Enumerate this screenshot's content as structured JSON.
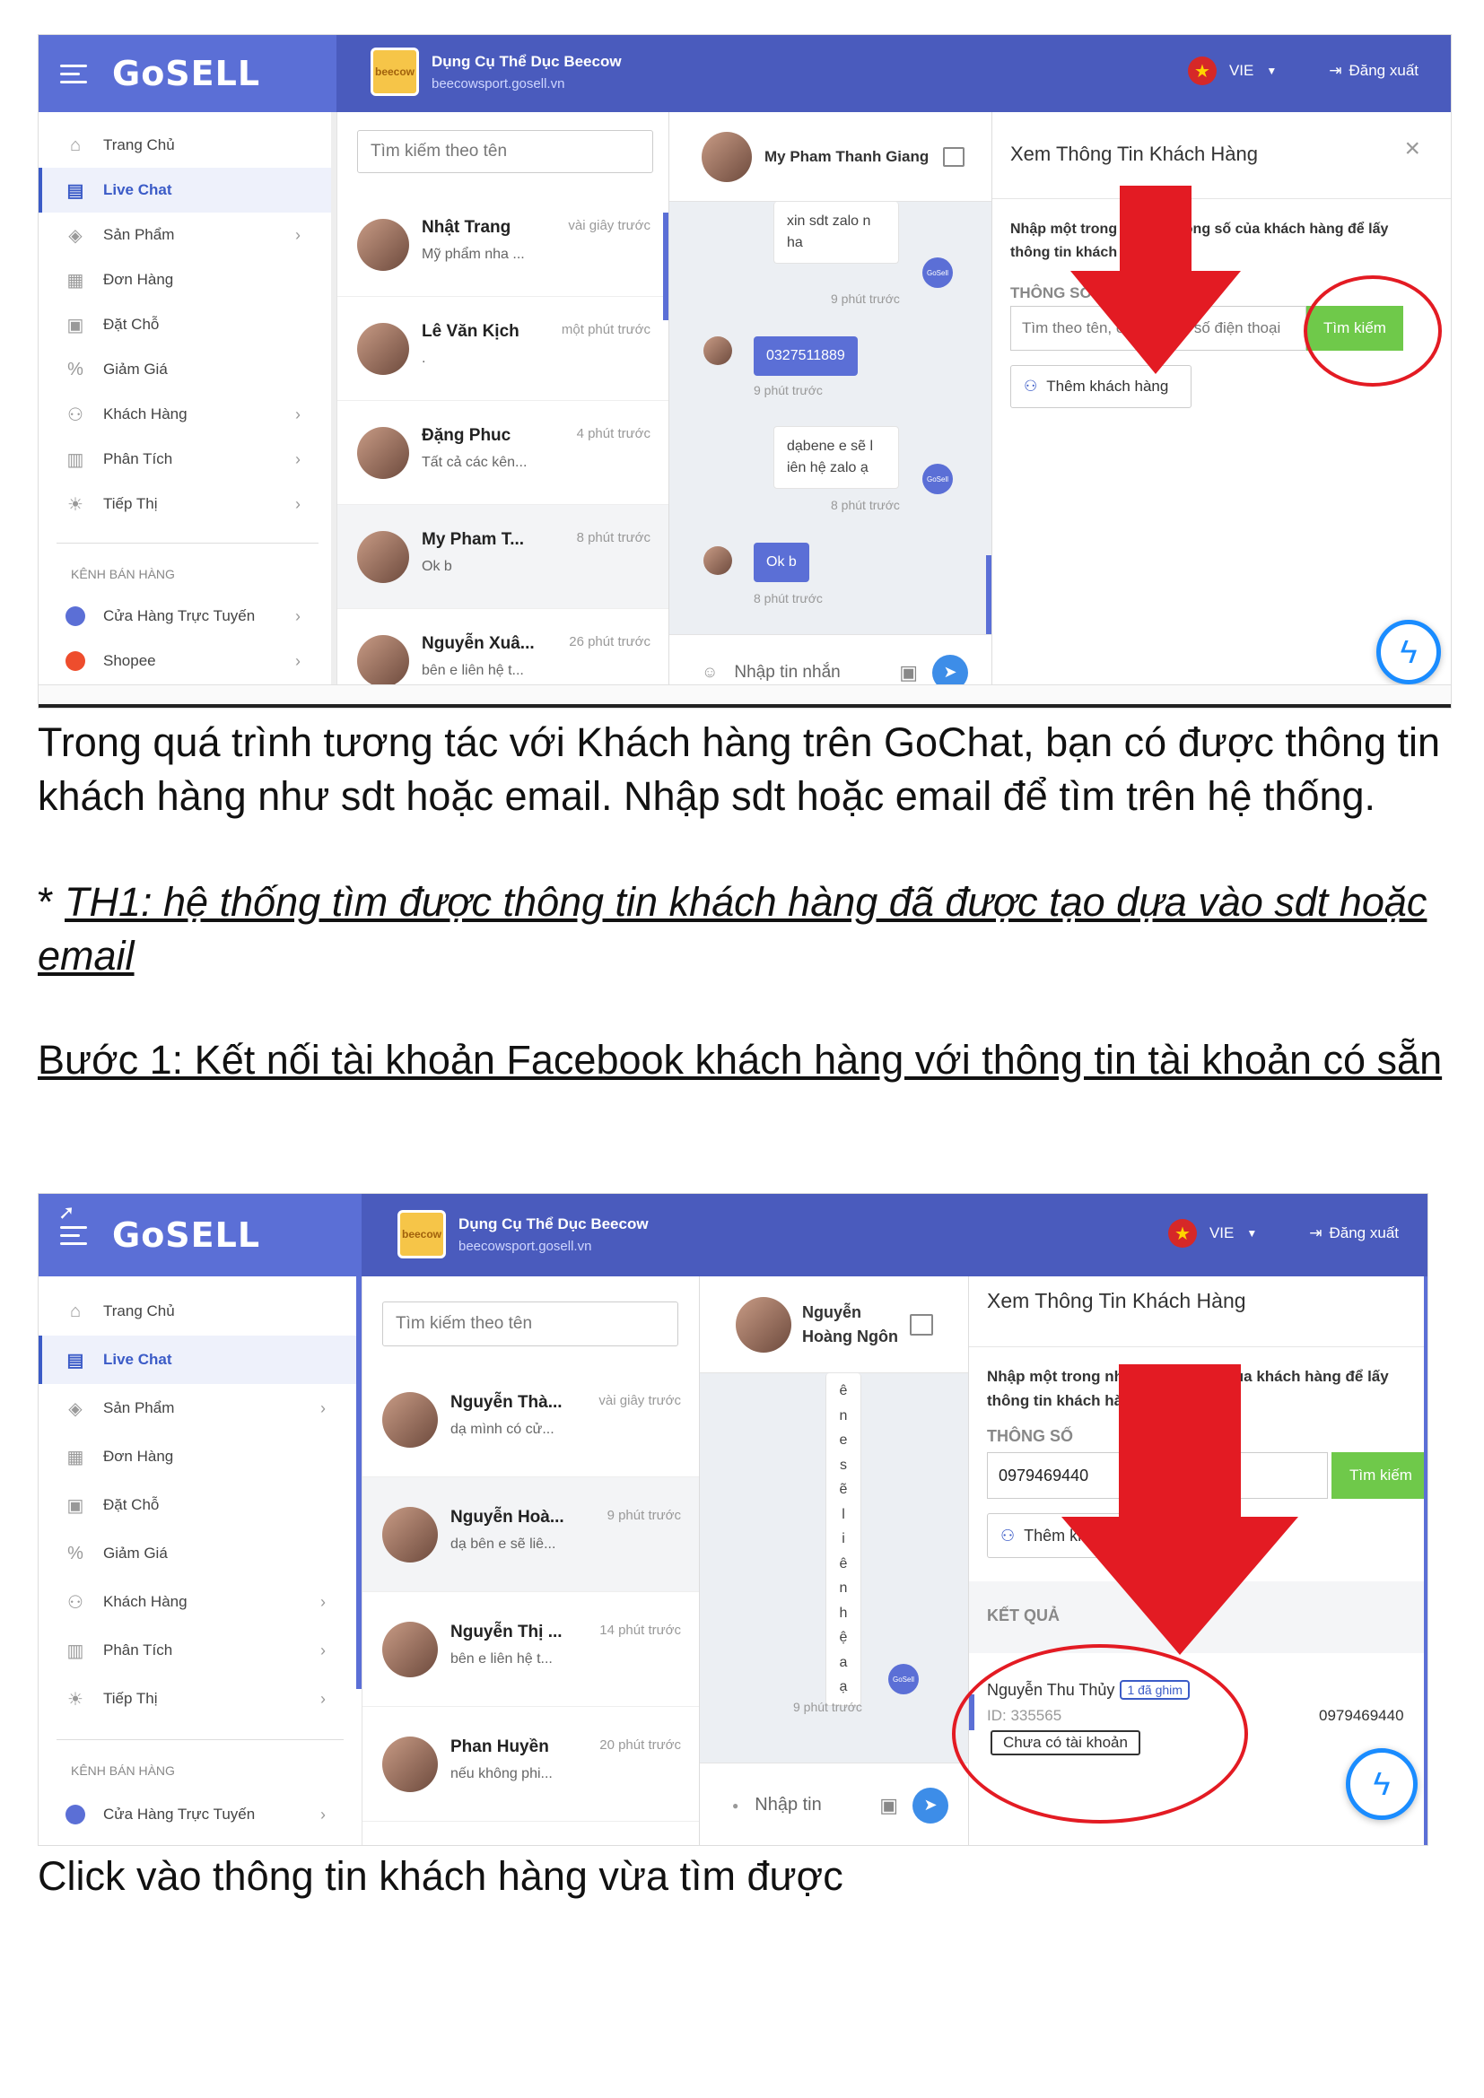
{
  "shot1": {
    "logo": "GoSELL",
    "shop": {
      "name": "Dụng Cụ Thể Dục Beecow",
      "url": "beecowsport.gosell.vn",
      "logo_text": "beecow"
    },
    "lang": "VIE",
    "logout": "Đăng xuất",
    "sidebar": [
      {
        "label": "Trang Chủ",
        "icon": "home-icon",
        "chev": false,
        "active": false
      },
      {
        "label": "Live Chat",
        "icon": "chat-icon",
        "chev": false,
        "active": true
      },
      {
        "label": "Sản Phẩm",
        "icon": "tag-icon",
        "chev": true,
        "active": false
      },
      {
        "label": "Đơn Hàng",
        "icon": "receipt-icon",
        "chev": false,
        "active": false
      },
      {
        "label": "Đặt Chỗ",
        "icon": "calendar-icon",
        "chev": false,
        "active": false
      },
      {
        "label": "Giảm Giá",
        "icon": "discount-icon",
        "chev": false,
        "active": false
      },
      {
        "label": "Khách Hàng",
        "icon": "users-icon",
        "chev": true,
        "active": false
      },
      {
        "label": "Phân Tích",
        "icon": "chart-icon",
        "chev": true,
        "active": false
      },
      {
        "label": "Tiếp Thị",
        "icon": "bulb-icon",
        "chev": true,
        "active": false
      }
    ],
    "channels_header": "KÊNH BÁN HÀNG",
    "channels": [
      {
        "label": "Cửa Hàng Trực Tuyến",
        "color": "#5b6fd6"
      },
      {
        "label": "Shopee",
        "color": "#ee4d2d"
      }
    ],
    "search_placeholder": "Tìm kiếm theo tên",
    "conversations": [
      {
        "name": "Nhật Trang",
        "time": "vài giây trước",
        "msg": "Mỹ phẩm nha ..."
      },
      {
        "name": "Lê Văn Kịch",
        "time": "một phút trước",
        "msg": "."
      },
      {
        "name": "Đặng Phuc",
        "time": "4 phút trước",
        "msg": "Tất cả các kên..."
      },
      {
        "name": "My Pham T...",
        "time": "8 phút trước",
        "msg": "Ok b"
      },
      {
        "name": "Nguyễn Xuâ...",
        "time": "26 phút trước",
        "msg": "bên e liên hệ t..."
      }
    ],
    "chat_header": "My Pham Thanh Giang",
    "messages": [
      {
        "text": "xin sdt zalo n ha",
        "time": "9 phút trước",
        "out": false
      },
      {
        "text": "0327511889",
        "time": "9 phút trước",
        "out": true
      },
      {
        "text": "dạbene e sẽ l iên hệ zalo ạ",
        "time": "8 phút trước",
        "out": false
      },
      {
        "text": "Ok b",
        "time": "8 phút trước",
        "out": true
      }
    ],
    "gosell_badge": "GoSell",
    "input_placeholder": "Nhập tin nhắn",
    "info": {
      "title": "Xem Thông Tin Khách Hàng",
      "desc": "Nhập một trong những thông số của khách hàng để lấy thông tin khách hàng",
      "label": "THÔNG SỐ",
      "input_placeholder": "Tìm theo tên, email hoặc số điện thoại",
      "search_btn": "Tìm kiếm",
      "add_btn": "Thêm khách hàng"
    },
    "accent": "#5b6fd6",
    "arrow_color": "#e31b23"
  },
  "caption1": "Trong quá trình tương tác với Khách hàng trên GoChat, bạn có được thông tin khách hàng như sdt hoặc email. Nhập sdt hoặc email để tìm trên hệ thống.",
  "caption2_prefix": "* ",
  "caption2": "TH1: hệ thống tìm được thông tin khách hàng đã được tạo dựa vào sdt hoặc email",
  "caption3": "Bước 1: Kết nối tài khoản Facebook khách hàng với thông tin tài khoản có sẵn",
  "shot2": {
    "logo": "GoSELL",
    "shop": {
      "name": "Dụng Cụ Thể Dục Beecow",
      "url": "beecowsport.gosell.vn",
      "logo_text": "beecow"
    },
    "lang": "VIE",
    "logout": "Đăng xuất",
    "sidebar": [
      {
        "label": "Trang Chủ",
        "icon": "home-icon",
        "chev": false,
        "active": false
      },
      {
        "label": "Live Chat",
        "icon": "chat-icon",
        "chev": false,
        "active": true
      },
      {
        "label": "Sản Phẩm",
        "icon": "tag-icon",
        "chev": true,
        "active": false
      },
      {
        "label": "Đơn Hàng",
        "icon": "receipt-icon",
        "chev": false,
        "active": false
      },
      {
        "label": "Đặt Chỗ",
        "icon": "calendar-icon",
        "chev": false,
        "active": false
      },
      {
        "label": "Giảm Giá",
        "icon": "discount-icon",
        "chev": false,
        "active": false
      },
      {
        "label": "Khách Hàng",
        "icon": "users-icon",
        "chev": true,
        "active": false
      },
      {
        "label": "Phân Tích",
        "icon": "chart-icon",
        "chev": true,
        "active": false
      },
      {
        "label": "Tiếp Thị",
        "icon": "bulb-icon",
        "chev": true,
        "active": false
      }
    ],
    "channels_header": "KÊNH BÁN HÀNG",
    "channels": [
      {
        "label": "Cửa Hàng Trực Tuyến",
        "color": "#5b6fd6"
      }
    ],
    "search_placeholder": "Tìm kiếm theo tên",
    "conversations": [
      {
        "name": "Nguyễn Thà...",
        "time": "vài giây trước",
        "msg": "dạ mình có cử..."
      },
      {
        "name": "Nguyễn Hoà...",
        "time": "9 phút trước",
        "msg": "dạ bên e sẽ liê..."
      },
      {
        "name": "Nguyễn Thị ...",
        "time": "14 phút trước",
        "msg": "bên e liên hệ t..."
      },
      {
        "name": "Phan Huyền",
        "time": "20 phút trước",
        "msg": "nếu không phi..."
      }
    ],
    "chat_header": "Nguyễn Hoàng Ngôn",
    "vertical_message": [
      "ê",
      "n",
      "e",
      "s",
      "ẽ",
      "l",
      "i",
      "ê",
      "n",
      "h",
      "ệ",
      "a",
      "ạ"
    ],
    "message_time": "9 phút trước",
    "gosell_badge": "GoSell",
    "input_placeholder": "Nhập tin",
    "info": {
      "title": "Xem Thông Tin Khách Hàng",
      "desc": "Nhập một trong những thông số của khách hàng để lấy thông tin khách hàng",
      "label": "THÔNG SỐ",
      "input_value": "0979469440",
      "search_btn": "Tìm kiếm",
      "add_btn": "Thêm khách hàng",
      "result_label": "KẾT QUẢ",
      "result_name": "Nguyễn Thu Thủy",
      "result_pin": "1 đã ghim",
      "result_id": "ID: 335565",
      "result_phone": "0979469440",
      "result_status": "Chưa có tài khoản"
    }
  },
  "caption4": "Click vào thông tin khách hàng vừa tìm được"
}
